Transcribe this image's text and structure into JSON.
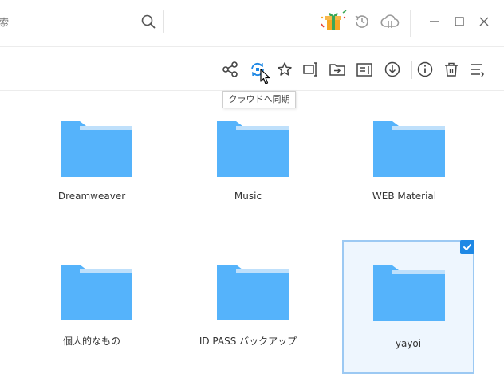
{
  "search": {
    "value": "索",
    "placeholder": ""
  },
  "titlebar": {
    "icons": [
      "gift-icon",
      "history-icon",
      "cloud-icon",
      "minimize-icon",
      "maximize-icon",
      "close-icon"
    ]
  },
  "toolbar": {
    "tools": [
      "share-icon",
      "cloud-sync-icon",
      "star-icon",
      "rename-icon",
      "move-icon",
      "text-icon",
      "download-icon",
      "info-icon",
      "trash-icon",
      "list-view-icon"
    ],
    "tooltip": "クラウドへ同期"
  },
  "colors": {
    "folder": "#55b3fb",
    "folder_tab_light": "#bfe0fb",
    "selected_bg": "#eef6fe",
    "selected_border": "#9cc9f3",
    "check": "#1e88e5",
    "icon": "#444444"
  },
  "folders": [
    {
      "name": "Dreamweaver",
      "selected": false
    },
    {
      "name": "Music",
      "selected": false
    },
    {
      "name": "WEB Material",
      "selected": false
    },
    {
      "name": "個人的なもの",
      "selected": false
    },
    {
      "name": "ID PASS バックアップ",
      "selected": false
    },
    {
      "name": "yayoi",
      "selected": true
    }
  ]
}
